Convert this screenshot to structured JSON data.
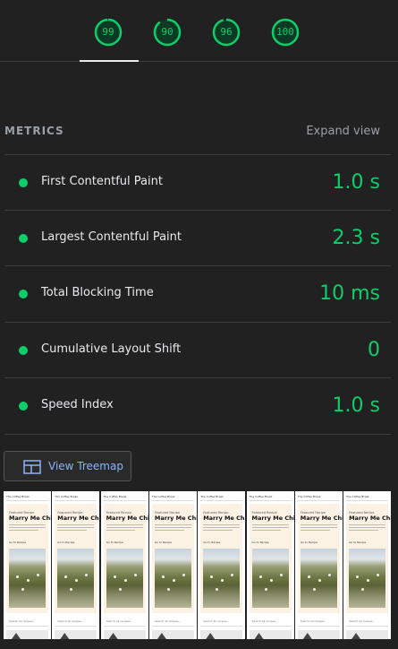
{
  "scores": [
    {
      "value": "99",
      "fraction": 0.99,
      "color": "#0cce6b"
    },
    {
      "value": "90",
      "fraction": 0.9,
      "color": "#0cce6b"
    },
    {
      "value": "96",
      "fraction": 0.96,
      "color": "#0cce6b"
    },
    {
      "value": "100",
      "fraction": 1.0,
      "color": "#0cce6b"
    }
  ],
  "metrics": {
    "title": "METRICS",
    "expand_label": "Expand view",
    "items": [
      {
        "label": "First Contentful Paint",
        "value": "1.0 s",
        "status_color": "#0cce6b"
      },
      {
        "label": "Largest Contentful Paint",
        "value": "2.3 s",
        "status_color": "#0cce6b"
      },
      {
        "label": "Total Blocking Time",
        "value": "10 ms",
        "status_color": "#0cce6b"
      },
      {
        "label": "Cumulative Layout Shift",
        "value": "0",
        "status_color": "#0cce6b"
      },
      {
        "label": "Speed Index",
        "value": "1.0 s",
        "status_color": "#0cce6b"
      }
    ]
  },
  "treemap": {
    "label": "View Treemap",
    "icon": "treemap-icon"
  },
  "filmstrip": {
    "frame_count": 8,
    "brand": "The Coffee Break",
    "eyebrow": "Featured Recipe",
    "title": "Marry Me Chicken",
    "jump": "Go to Recipe",
    "search": "Search all recipes..."
  },
  "colors": {
    "pass": "#0cce6b",
    "link": "#8ab4f8",
    "background": "#212121"
  }
}
